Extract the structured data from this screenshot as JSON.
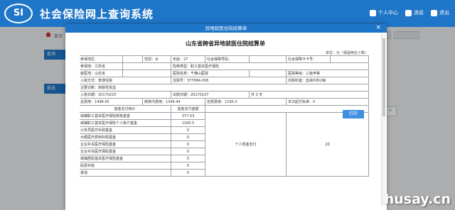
{
  "header": {
    "logo_text": "SI",
    "title": "社会保险网上查询系统",
    "links": [
      {
        "label": "个人中心"
      },
      {
        "label": "消息"
      },
      {
        "label": "退出"
      }
    ]
  },
  "breadcrumb": "首页",
  "side_panels": [
    {
      "label": "查询"
    },
    {
      "label": "报送"
    }
  ],
  "dialog": {
    "header_title": "异地就医住院结算单",
    "close_symbol": "×",
    "report_title": "山东省跨省异地就医住院结算单",
    "unit_label": "单位：元（保留两位小数）",
    "print_button": "打印"
  },
  "bg_side_label": "个",
  "table": {
    "rows": [
      [
        {
          "t": "参保地区："
        },
        {
          "t": "",
          "span": 1
        },
        {
          "t": "性别：女"
        },
        {
          "t": "年龄：27"
        },
        {
          "t": "社会保障号码："
        },
        {
          "t": "",
          "span": 1
        },
        {
          "t": "社会保障卡卡号："
        },
        {
          "t": ""
        }
      ],
      [
        {
          "t": "参保地：江苏省"
        },
        {
          "t": "",
          "span": 2
        },
        {
          "t": "险种类型：职工基本医疗保险",
          "span": 5
        }
      ],
      [
        {
          "t": "就医地：山东省"
        },
        {
          "t": "",
          "span": 2
        },
        {
          "t": "医院名称：千佛山医院",
          "span": 2
        },
        {
          "t": "",
          "span": 1
        },
        {
          "t": "医院等级：三级甲等",
          "span": 2
        }
      ],
      [
        {
          "t": "入院方式：普通住院",
          "span": 3
        },
        {
          "t": "住院号：377684-006",
          "span": 3
        },
        {
          "t": "出院科室：血液内科2病",
          "span": 2
        }
      ],
      [
        {
          "t": "主要诊断：缺铁性贫血",
          "span": 8
        }
      ],
      [
        {
          "t": "入院日期：20170225",
          "span": 3
        },
        {
          "t": "出院日期：20170227",
          "span": 2
        },
        {
          "t": "共 3 天",
          "span": 3
        }
      ],
      [
        {
          "t": "总费用：1498.05",
          "span": 2
        },
        {
          "t": "统筹内费用：1349.44",
          "span": 2
        },
        {
          "t": "自费费用：1100.3",
          "span": 2
        },
        {
          "t": "本次起付标准：0",
          "span": 2
        }
      ]
    ],
    "fund_header": [
      "基金支付统计",
      "基金支付金额"
    ],
    "fund_rows": [
      {
        "name": "城镇职工基本医疗保险统筹基金",
        "amount": "377.53"
      },
      {
        "name": "城镇职工基本医疗保险个人账户基金",
        "amount": "1100.5"
      },
      {
        "name": "公务员医疗补助基金",
        "amount": "0"
      },
      {
        "name": "大额医疗费用补助基金",
        "amount": "0"
      },
      {
        "name": "企业补充医疗保险基金",
        "amount": "0"
      },
      {
        "name": "企业补充医疗保险基金",
        "amount": "0"
      },
      {
        "name": "城镇居民基本医疗保险基金",
        "amount": "0"
      },
      {
        "name": "民政补助",
        "amount": "0"
      },
      {
        "name": "其他",
        "amount": "0"
      }
    ],
    "personal_pay_label": "个人现金支付",
    "personal_pay_amount": "20"
  },
  "watermark": "husay.cn"
}
